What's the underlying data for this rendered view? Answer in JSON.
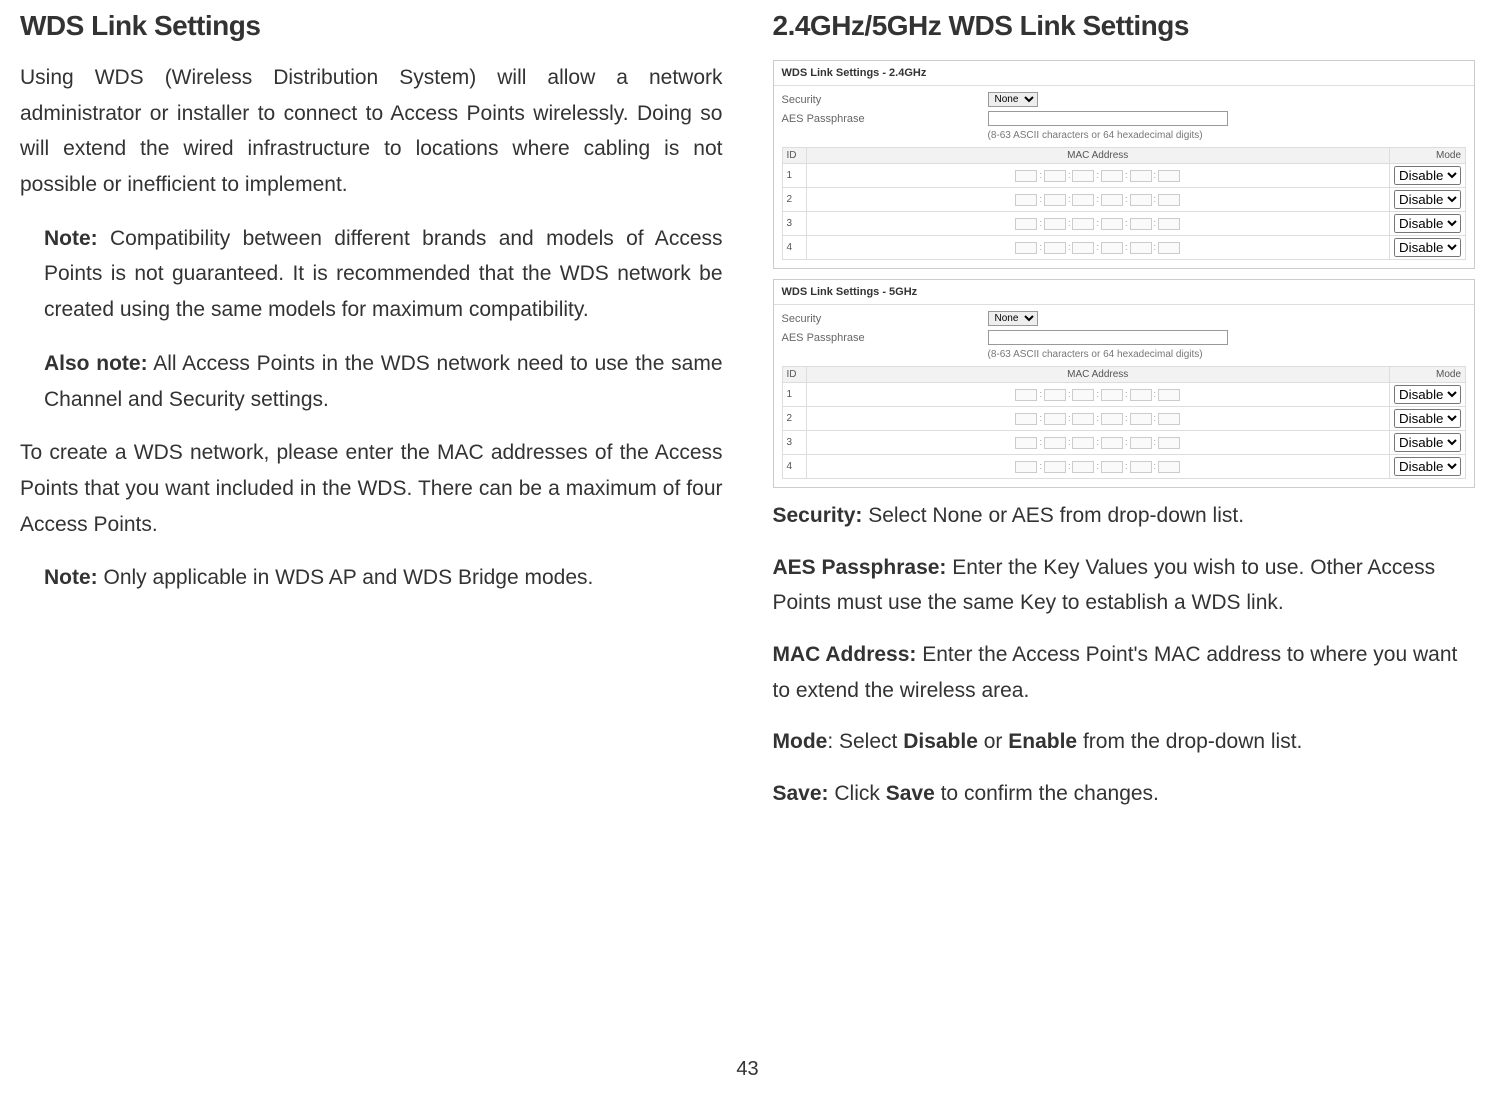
{
  "page_number": "43",
  "left": {
    "heading": "WDS Link Settings",
    "p1": "Using WDS (Wireless Distribution System) will allow a network administrator or installer to connect to Access Points wirelessly. Doing so will extend the wired infrastructure to locations where cabling is not possible or inefficient to implement.",
    "note1_label": "Note:",
    "note1_text": " Compatibility between different brands and models of Access Points is not guaranteed. It is recommended that the WDS network be created using the same models for maximum compatibility.",
    "note2_label": "Also note:",
    "note2_text": " All Access Points in the WDS network need to use the same Channel and Security settings.",
    "p2": "To create a WDS network, please enter the MAC addresses of the Access Points that you want included in the WDS. There can be a maximum of four Access Points.",
    "note3_label": "Note:",
    "note3_text": " Only applicable in WDS AP and WDS Bridge modes."
  },
  "right": {
    "heading": "2.4GHz/5GHz WDS Link Settings",
    "panels": [
      {
        "title": "WDS Link Settings - 2.4GHz",
        "security_label": "Security",
        "security_value": "None",
        "aes_label": "AES Passphrase",
        "aes_hint": "(8-63 ASCII characters or 64 hexadecimal digits)",
        "cols": {
          "id": "ID",
          "mac": "MAC Address",
          "mode": "Mode"
        },
        "rows": [
          {
            "id": "1",
            "mode": "Disable"
          },
          {
            "id": "2",
            "mode": "Disable"
          },
          {
            "id": "3",
            "mode": "Disable"
          },
          {
            "id": "4",
            "mode": "Disable"
          }
        ]
      },
      {
        "title": "WDS Link Settings - 5GHz",
        "security_label": "Security",
        "security_value": "None",
        "aes_label": "AES Passphrase",
        "aes_hint": "(8-63 ASCII characters or 64 hexadecimal digits)",
        "cols": {
          "id": "ID",
          "mac": "MAC Address",
          "mode": "Mode"
        },
        "rows": [
          {
            "id": "1",
            "mode": "Disable"
          },
          {
            "id": "2",
            "mode": "Disable"
          },
          {
            "id": "3",
            "mode": "Disable"
          },
          {
            "id": "4",
            "mode": "Disable"
          }
        ]
      }
    ],
    "defs": {
      "security_label": "Security:",
      "security_text": " Select None or AES from drop-down list.",
      "aes_label": "AES Passphrase:",
      "aes_text": " Enter the Key Values you wish to use. Other Access Points must use the same Key to establish a WDS link.",
      "mac_label": "MAC Address:",
      "mac_text": " Enter the Access Point's MAC address to where you want to extend the wireless area.",
      "mode_label": "Mode",
      "mode_sep": ": Select ",
      "mode_opt1": "Disable",
      "mode_or": " or ",
      "mode_opt2": "Enable",
      "mode_text": " from the drop-down list.",
      "save_label": "Save:",
      "save_pre": " Click ",
      "save_btn": "Save",
      "save_text": " to confirm the changes."
    }
  }
}
